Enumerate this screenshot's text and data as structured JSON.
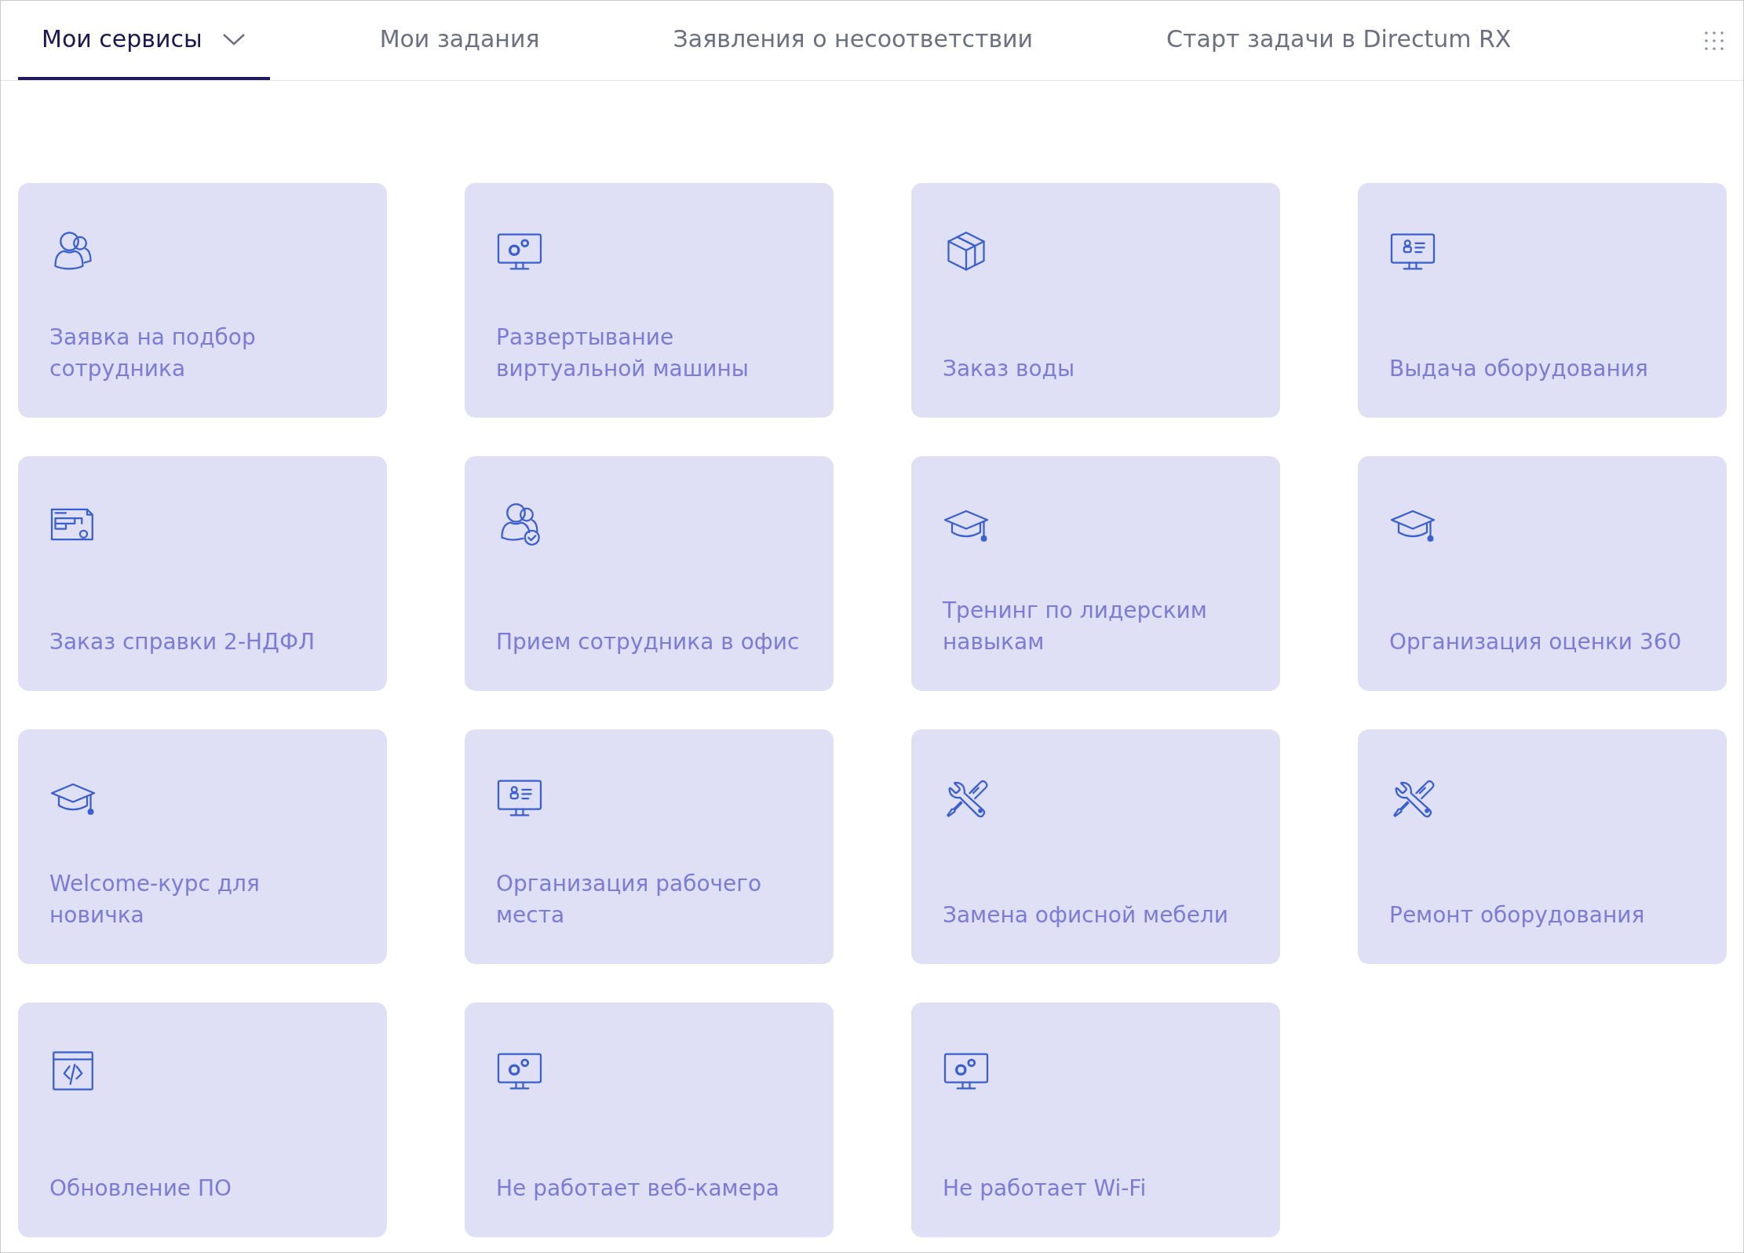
{
  "tabs": [
    {
      "label": "Мои сервисы",
      "selected": true,
      "dropdown": true
    },
    {
      "label": "Мои задания",
      "selected": false,
      "dropdown": false
    },
    {
      "label": "Заявления о несоответствии",
      "selected": false,
      "dropdown": false
    },
    {
      "label": "Старт задачи в Directum RX",
      "selected": false,
      "dropdown": false
    }
  ],
  "services": [
    {
      "title": "Заявка на подбор сотрудника",
      "kind": "people"
    },
    {
      "title": "Развертывание виртуальной машины",
      "kind": "monitor-gears"
    },
    {
      "title": "Заказ воды",
      "kind": "box"
    },
    {
      "title": "Выдача оборудования",
      "kind": "monitor-person"
    },
    {
      "title": "Заказ справки 2-НДФЛ",
      "kind": "document"
    },
    {
      "title": "Прием сотрудника в офис",
      "kind": "people-check"
    },
    {
      "title": "Тренинг по лидерским навыкам",
      "kind": "cap"
    },
    {
      "title": "Организация оценки 360",
      "kind": "cap"
    },
    {
      "title": "Welcome-курс для новичка",
      "kind": "cap"
    },
    {
      "title": "Организация рабочего места",
      "kind": "monitor-person"
    },
    {
      "title": "Замена офисной мебели",
      "kind": "tools"
    },
    {
      "title": "Ремонт оборудования",
      "kind": "tools"
    },
    {
      "title": "Обновление ПО",
      "kind": "code"
    },
    {
      "title": "Не работает веб-камера",
      "kind": "monitor-gears"
    },
    {
      "title": "Не работает Wi-Fi",
      "kind": "monitor-gears"
    }
  ]
}
